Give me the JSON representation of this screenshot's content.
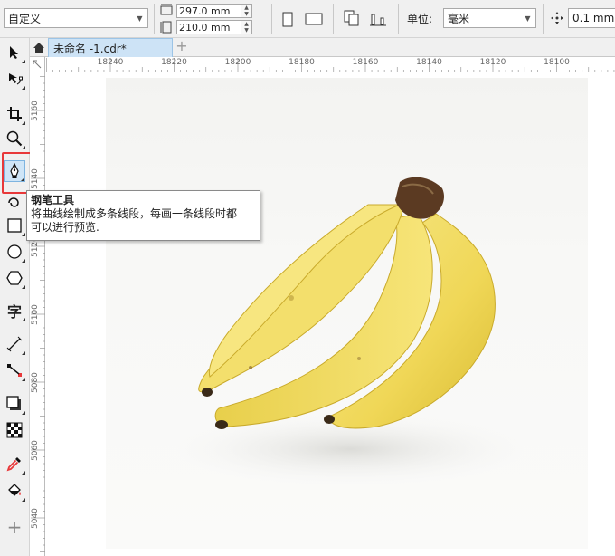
{
  "propbar": {
    "page_size": "自定义",
    "width": "297.0 mm",
    "height": "210.0 mm",
    "unit_label": "单位:",
    "unit_value": "毫米",
    "nudge": "0.1 mm"
  },
  "toolbox": {
    "tools": [
      {
        "name": "pick-tool",
        "icon": "arrow-pointer-icon"
      },
      {
        "name": "shape-tool",
        "icon": "node-edit-icon"
      },
      {
        "name": "crop-tool",
        "icon": "crop-icon"
      },
      {
        "name": "zoom-tool",
        "icon": "magnifier-icon"
      },
      {
        "name": "pen-tool",
        "icon": "pen-nib-icon",
        "active": true
      },
      {
        "name": "artistic-media-tool",
        "icon": "spiral-icon"
      },
      {
        "name": "rectangle-tool",
        "icon": "rectangle-icon"
      },
      {
        "name": "ellipse-tool",
        "icon": "ellipse-icon"
      },
      {
        "name": "polygon-tool",
        "icon": "hexagon-icon"
      },
      {
        "name": "text-tool",
        "icon": "text-icon"
      },
      {
        "name": "parallel-dimension-tool",
        "icon": "dimension-icon"
      },
      {
        "name": "connector-tool",
        "icon": "connector-icon"
      },
      {
        "name": "drop-shadow-tool",
        "icon": "shadow-icon"
      },
      {
        "name": "transparency-tool",
        "icon": "checker-icon"
      },
      {
        "name": "eyedropper-tool",
        "icon": "eyedropper-icon"
      },
      {
        "name": "interactive-fill-tool",
        "icon": "paint-bucket-icon"
      },
      {
        "name": "add-tool",
        "icon": "plus-icon"
      }
    ],
    "text_glyph": "字",
    "plus_glyph": "+"
  },
  "tabs": {
    "document": "未命名 -1.cdr*",
    "add": "+"
  },
  "ruler": {
    "h_labels": [
      "18240",
      "18220",
      "18200",
      "18180",
      "18160",
      "18140",
      "18120",
      "18100"
    ],
    "v_labels": [
      "5160",
      "5140",
      "5120",
      "5100",
      "5080",
      "5060",
      "5040"
    ]
  },
  "tooltip": {
    "title": "钢笔工具",
    "line1": "将曲线绘制成多条线段，每画一条线段时都",
    "line2": "可以进行预览."
  },
  "colors": {
    "highlight": "#e8383a",
    "banana": "#f2dc6a",
    "stem": "#5b3a22"
  }
}
